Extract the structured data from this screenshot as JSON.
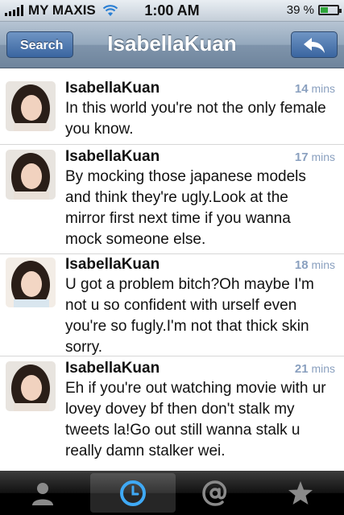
{
  "status": {
    "carrier": "MY MAXIS",
    "time": "1:00 AM",
    "battery": "39 %",
    "battery_level": 0.39
  },
  "nav": {
    "back_label": "Search",
    "title": "IsabellaKuan",
    "reply_icon": "reply-arrow-icon"
  },
  "tweets": [
    {
      "name": "IsabellaKuan",
      "time_num": "14",
      "time_unit": "mins",
      "text": "In this world you're not the only female you know."
    },
    {
      "name": "IsabellaKuan",
      "time_num": "17",
      "time_unit": "mins",
      "text": "By mocking those japanese models and think they're ugly.Look at the mirror first next time if you wanna mock someone else."
    },
    {
      "name": "IsabellaKuan",
      "time_num": "18",
      "time_unit": "mins",
      "text": "U got a problem bitch?Oh maybe I'm not u so confident with urself even you're so fugly.I'm not that thick skin sorry."
    },
    {
      "name": "IsabellaKuan",
      "time_num": "21",
      "time_unit": "mins",
      "text": "Eh if you're out watching movie with ur lovey dovey bf then don't stalk my tweets la!Go out still wanna stalk u really damn stalker wei."
    }
  ],
  "tabs": [
    {
      "icon": "person-icon",
      "active": false
    },
    {
      "icon": "clock-icon",
      "active": true
    },
    {
      "icon": "at-sign-icon",
      "active": false
    },
    {
      "icon": "star-icon",
      "active": false
    }
  ],
  "colors": {
    "nav_bar": "#8aa0b8",
    "time_accent": "#8aa0bf",
    "battery_fill": "#2fa63a"
  }
}
